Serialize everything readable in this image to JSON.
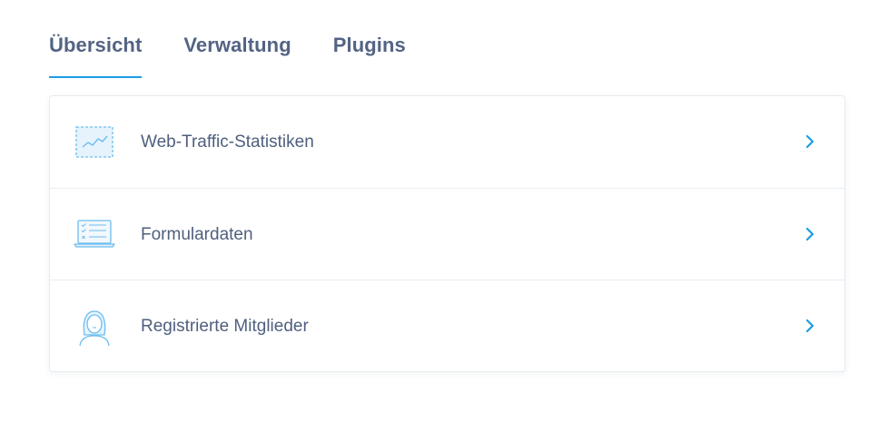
{
  "tabs": [
    {
      "label": "Übersicht",
      "active": true
    },
    {
      "label": "Verwaltung",
      "active": false
    },
    {
      "label": "Plugins",
      "active": false
    }
  ],
  "items": [
    {
      "label": "Web-Traffic-Statistiken",
      "icon": "chart-icon"
    },
    {
      "label": "Formulardaten",
      "icon": "form-laptop-icon"
    },
    {
      "label": "Registrierte Mitglieder",
      "icon": "member-icon"
    }
  ],
  "colors": {
    "accent": "#1a9de6",
    "text": "#4f5f7e",
    "icon": "#5bb3ea"
  }
}
